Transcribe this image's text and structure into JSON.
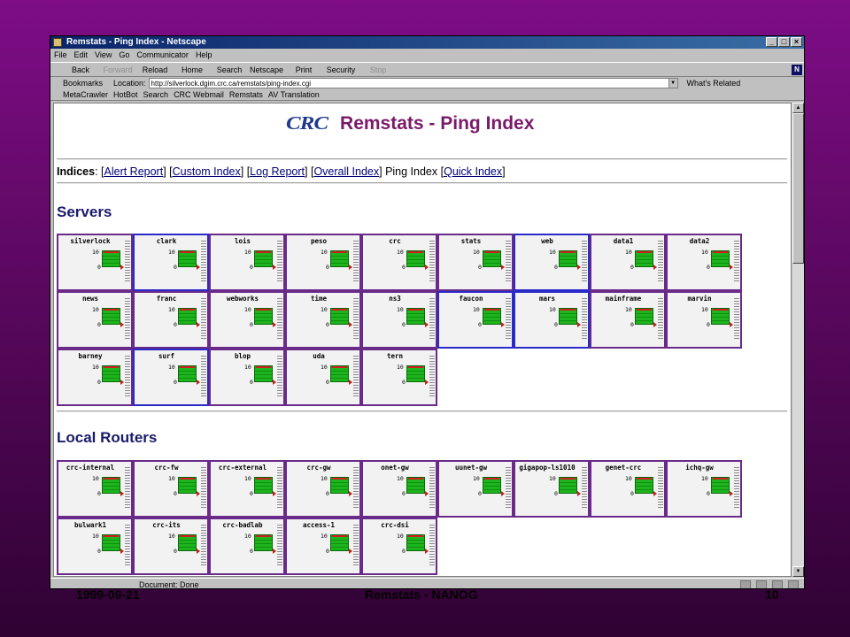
{
  "window": {
    "title": "Remstats - Ping Index - Netscape"
  },
  "menu": [
    "File",
    "Edit",
    "View",
    "Go",
    "Communicator",
    "Help"
  ],
  "nav": [
    {
      "label": "Back",
      "enabled": true
    },
    {
      "label": "Forward",
      "enabled": false
    },
    {
      "label": "Reload",
      "enabled": true
    },
    {
      "label": "Home",
      "enabled": true
    },
    {
      "label": "Search",
      "enabled": true
    },
    {
      "label": "Netscape",
      "enabled": true
    },
    {
      "label": "Print",
      "enabled": true
    },
    {
      "label": "Security",
      "enabled": true
    },
    {
      "label": "Stop",
      "enabled": false
    }
  ],
  "location": {
    "bookmarks_label": "Bookmarks",
    "location_label": "Location:",
    "url": "http://silverlock.dgim.crc.ca/remstats/ping-index.cgi",
    "related_label": "What's Related"
  },
  "personal": [
    "MetaCrawler",
    "HotBot",
    "Search",
    "CRC Webmail",
    "Remstats",
    "AV Translation"
  ],
  "page": {
    "logo_text": "CRC",
    "title": "Remstats - Ping Index",
    "indices_label": "Indices",
    "indices": [
      {
        "text": "Alert Report",
        "link": true
      },
      {
        "text": "Custom Index",
        "link": true
      },
      {
        "text": "Log Report",
        "link": true
      },
      {
        "text": "Overall Index",
        "link": true
      },
      {
        "text": "Ping Index",
        "link": false
      },
      {
        "text": "Quick Index",
        "link": true
      }
    ],
    "tick_top": "10",
    "tick_bottom": "0",
    "sections": [
      {
        "title": "Servers",
        "hosts": [
          {
            "name": "silverlock",
            "hl": false
          },
          {
            "name": "clark",
            "hl": true
          },
          {
            "name": "lois",
            "hl": false
          },
          {
            "name": "peso",
            "hl": false
          },
          {
            "name": "crc",
            "hl": false
          },
          {
            "name": "stats",
            "hl": false
          },
          {
            "name": "web",
            "hl": true
          },
          {
            "name": "data1",
            "hl": false
          },
          {
            "name": "data2",
            "hl": false
          },
          {
            "name": "news",
            "hl": false
          },
          {
            "name": "franc",
            "hl": false
          },
          {
            "name": "webworks",
            "hl": false
          },
          {
            "name": "time",
            "hl": false
          },
          {
            "name": "ns3",
            "hl": false
          },
          {
            "name": "faucon",
            "hl": true
          },
          {
            "name": "mars",
            "hl": true
          },
          {
            "name": "mainframe",
            "hl": false
          },
          {
            "name": "marvin",
            "hl": false
          },
          {
            "name": "barney",
            "hl": false
          },
          {
            "name": "surf",
            "hl": true
          },
          {
            "name": "blop",
            "hl": false
          },
          {
            "name": "uda",
            "hl": false
          },
          {
            "name": "tern",
            "hl": false
          }
        ]
      },
      {
        "title": "Local Routers",
        "hosts": [
          {
            "name": "crc-internal",
            "hl": false
          },
          {
            "name": "crc-fw",
            "hl": false
          },
          {
            "name": "crc-external",
            "hl": false
          },
          {
            "name": "crc-gw",
            "hl": false
          },
          {
            "name": "onet-gw",
            "hl": false
          },
          {
            "name": "uunet-gw",
            "hl": false
          },
          {
            "name": "gigapop-ls1010",
            "hl": false
          },
          {
            "name": "genet-crc",
            "hl": false
          },
          {
            "name": "ichq-gw",
            "hl": false
          },
          {
            "name": "bulwark1",
            "hl": false
          },
          {
            "name": "crc-its",
            "hl": false
          },
          {
            "name": "crc-badlab",
            "hl": false
          },
          {
            "name": "access-1",
            "hl": false
          },
          {
            "name": "crc-dsi",
            "hl": false
          }
        ]
      }
    ]
  },
  "status": {
    "text": "Document: Done"
  },
  "slide": {
    "date": "1999-09-21",
    "title": "Remstats - NANOG",
    "page": "10"
  }
}
